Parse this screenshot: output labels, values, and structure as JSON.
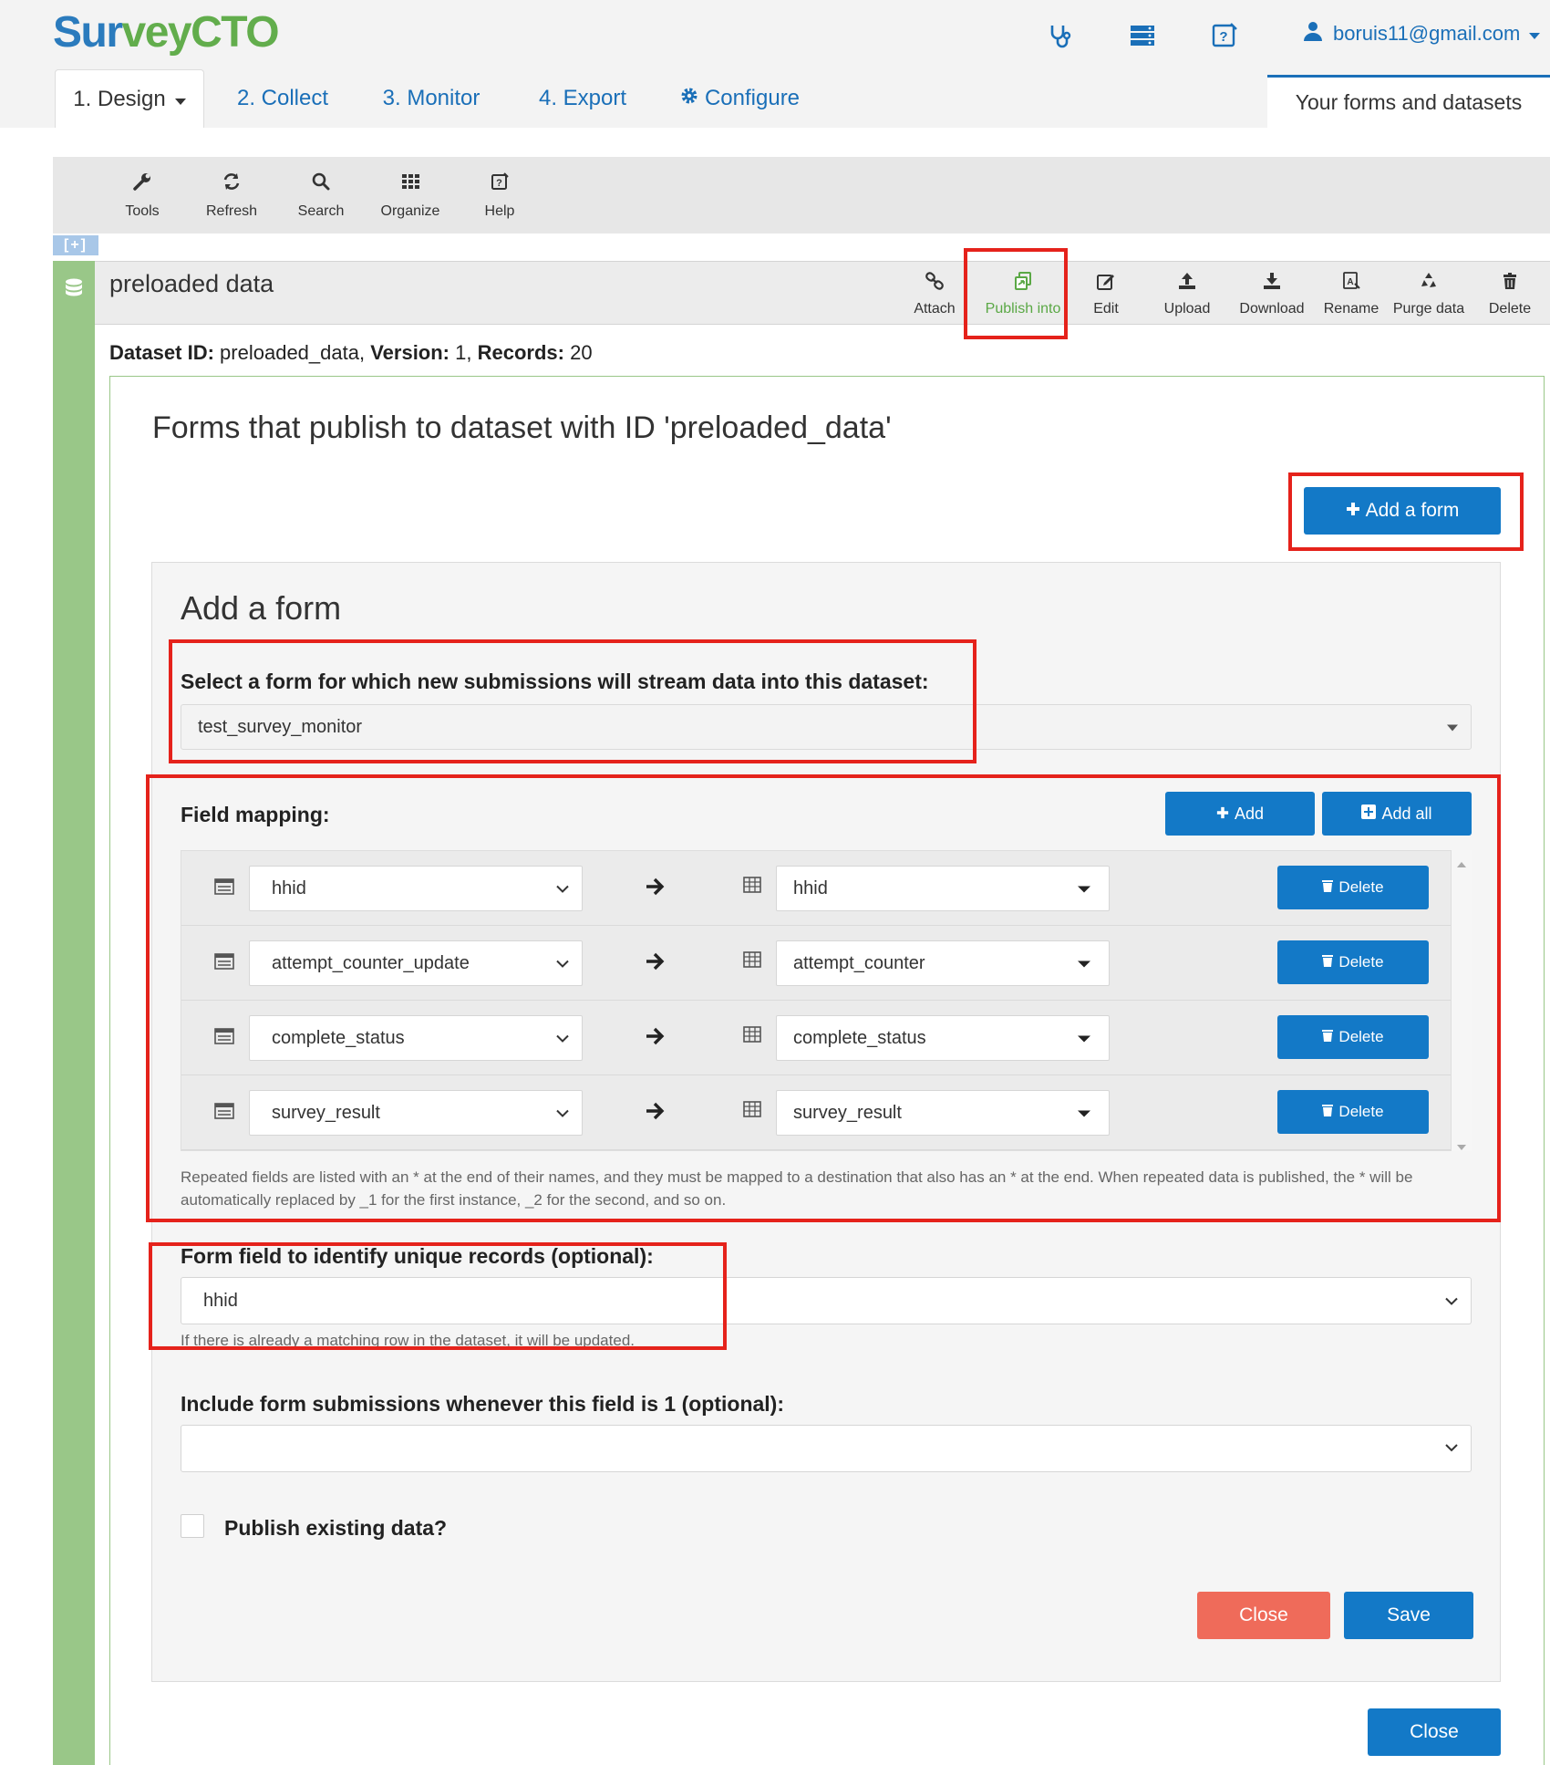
{
  "header": {
    "logo_part1": "Sur",
    "logo_part2": "vey",
    "logo_part3": "CTO",
    "user_email": "boruis11@gmail.com",
    "icons": [
      "stethoscope-icon",
      "server-icon",
      "help-edit-icon",
      "user-icon"
    ]
  },
  "nav": {
    "tabs": [
      {
        "label": "1. Design",
        "active": true
      },
      {
        "label": "2. Collect"
      },
      {
        "label": "3. Monitor"
      },
      {
        "label": "4. Export"
      },
      {
        "label": "Configure",
        "icon": "gear-icon"
      }
    ],
    "right_tab": "Your forms and datasets"
  },
  "toolbar": {
    "items": [
      {
        "label": "Tools",
        "icon": "wrench-icon"
      },
      {
        "label": "Refresh",
        "icon": "refresh-icon"
      },
      {
        "label": "Search",
        "icon": "search-icon"
      },
      {
        "label": "Organize",
        "icon": "grid-icon"
      },
      {
        "label": "Help",
        "icon": "help-icon"
      }
    ],
    "collapse_label": "[+]"
  },
  "dataset": {
    "title": "preloaded data",
    "actions": [
      {
        "label": "Attach",
        "icon": "link-icon"
      },
      {
        "label": "Publish into",
        "icon": "publish-icon",
        "active": true
      },
      {
        "label": "Edit",
        "icon": "edit-icon"
      },
      {
        "label": "Upload",
        "icon": "upload-icon"
      },
      {
        "label": "Download",
        "icon": "download-icon"
      },
      {
        "label": "Rename",
        "icon": "rename-icon"
      },
      {
        "label": "Purge data",
        "icon": "recycle-icon"
      },
      {
        "label": "Delete",
        "icon": "trash-icon"
      }
    ],
    "meta": {
      "id_label": "Dataset ID:",
      "id_value": "preloaded_data,",
      "version_label": "Version:",
      "version_value": "1,",
      "records_label": "Records:",
      "records_value": "20"
    }
  },
  "panel": {
    "title": "Forms that publish to dataset with ID 'preloaded_data'",
    "add_form_button": "Add a form"
  },
  "add_form": {
    "heading": "Add a form",
    "select_label": "Select a form for which new submissions will stream data into this dataset:",
    "selected_form": "test_survey_monitor",
    "field_mapping_label": "Field mapping:",
    "add_label": "Add",
    "add_all_label": "Add all",
    "mappings": [
      {
        "source": "hhid",
        "destination": "hhid",
        "delete_label": "Delete"
      },
      {
        "source": "attempt_counter_update",
        "destination": "attempt_counter",
        "delete_label": "Delete"
      },
      {
        "source": "complete_status",
        "destination": "complete_status",
        "delete_label": "Delete"
      },
      {
        "source": "survey_result",
        "destination": "survey_result",
        "delete_label": "Delete"
      }
    ],
    "repeat_note": "Repeated fields are listed with an * at the end of their names, and they must be mapped to a destination that also has an * at the end. When repeated data is published, the * will be automatically replaced by _1 for the first instance, _2 for the second, and so on.",
    "unique_label": "Form field to identify unique records (optional):",
    "unique_value": "hhid",
    "unique_help": "If there is already a matching row in the dataset, it will be updated.",
    "include_label": "Include form submissions whenever this field is 1 (optional):",
    "include_value": "",
    "publish_existing_label": "Publish existing data?",
    "publish_existing_checked": false,
    "close_label": "Close",
    "save_label": "Save"
  },
  "footer": {
    "close_label": "Close"
  },
  "colors": {
    "primary": "#1379c7",
    "danger": "#ef6b5a",
    "green_strip": "#99c788",
    "annotation_red": "#e5221b",
    "link_blue": "#1a6fb8"
  }
}
